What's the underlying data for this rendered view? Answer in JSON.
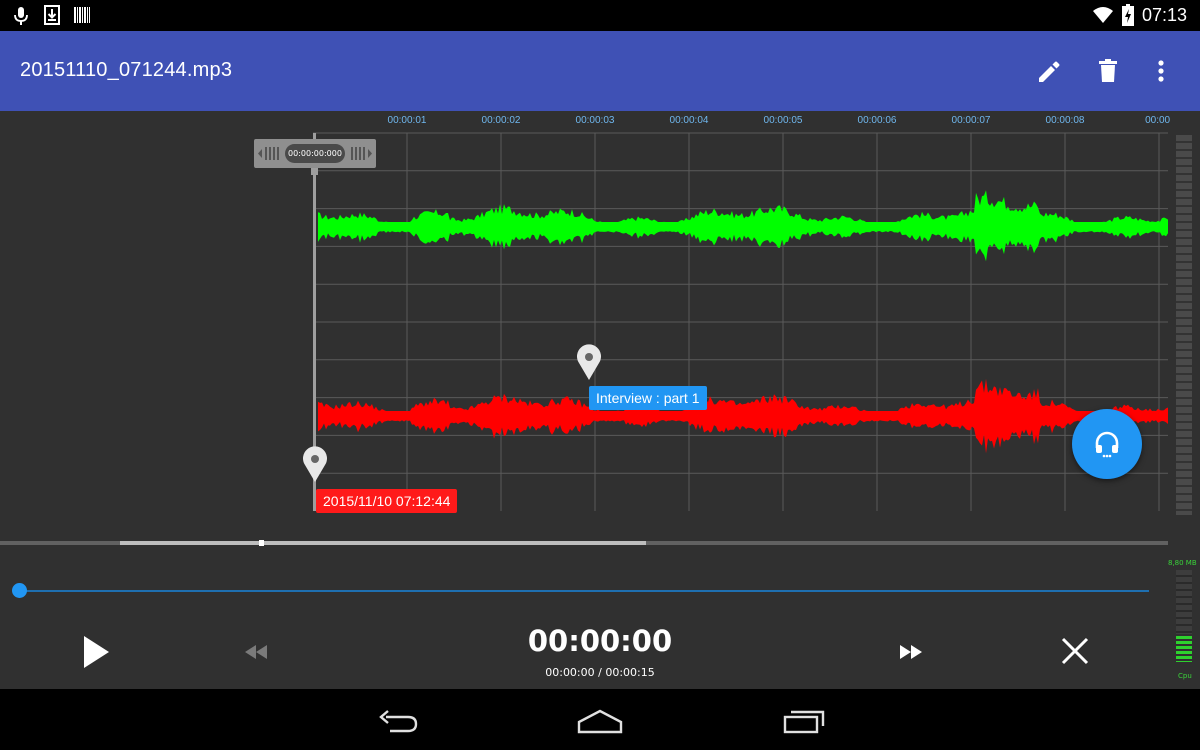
{
  "status_bar": {
    "time": "07:13",
    "icons_left": [
      "mic-icon",
      "download-icon",
      "barcode-icon"
    ],
    "icons_right": [
      "wifi-icon",
      "battery-charging-icon"
    ]
  },
  "app_bar": {
    "title": "20151110_071244.mp3",
    "actions": [
      "edit-icon",
      "delete-icon",
      "more-vert-icon"
    ]
  },
  "timeline": {
    "ticks": [
      "00:00:01",
      "00:00:02",
      "00:00:03",
      "00:00:04",
      "00:00:05",
      "00:00:06",
      "00:00:07",
      "00:00:08",
      "00:00:"
    ]
  },
  "playhead": {
    "time": "00:00:00:000"
  },
  "markers": [
    {
      "label": "2015/11/10 07:12:44",
      "color": "#ff1a1a"
    },
    {
      "label": "Interview : part 1",
      "color": "#2196f3"
    }
  ],
  "channels": [
    {
      "name": "left",
      "color": "#00ff00"
    },
    {
      "name": "right",
      "color": "#ff0000"
    }
  ],
  "transport": {
    "current_time": "00:00:00",
    "position_total": "00:00:00 / 00:00:15",
    "progress": 0.0
  },
  "meters": {
    "top_label": "8,80 MB",
    "bottom_label": "Cpu"
  },
  "colors": {
    "appbar": "#3f51b5",
    "accent": "#2196f3",
    "background": "#303030"
  }
}
